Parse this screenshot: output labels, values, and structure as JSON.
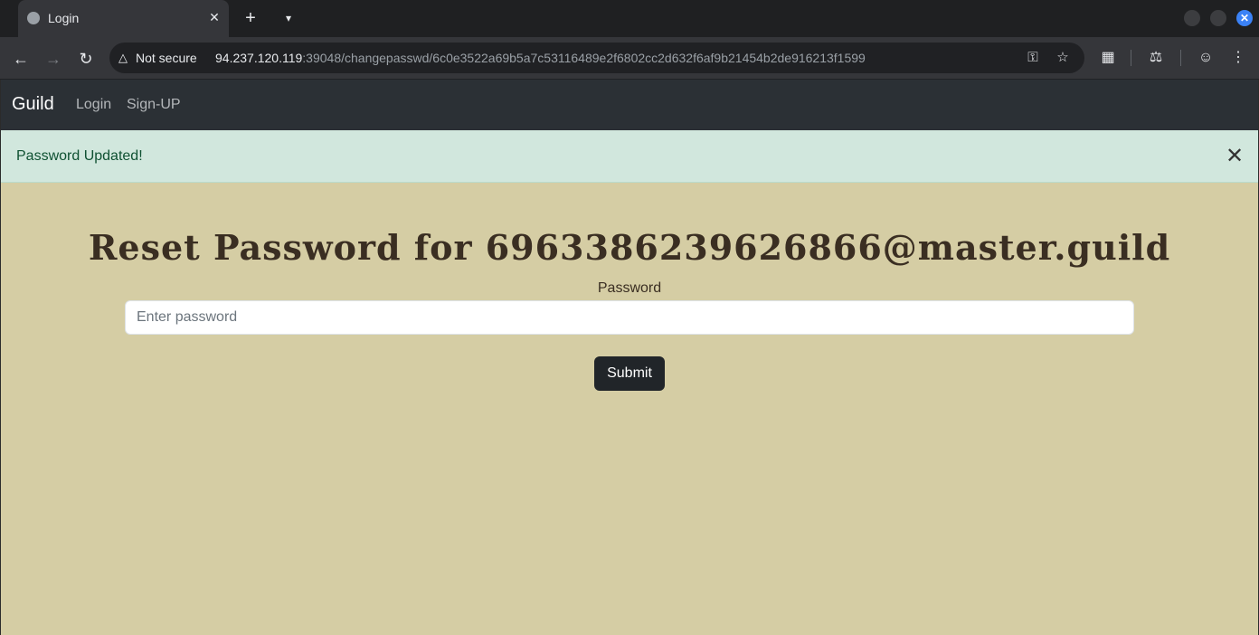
{
  "browser": {
    "tab_title": "Login",
    "tab_close": "✕",
    "new_tab": "+",
    "tab_menu": "⌄",
    "not_secure": "Not secure",
    "url_host": "94.237.120.119",
    "url_rest": ":39048/changepasswd/6c0e3522a69b5a7c53116489e2f6802cc2d632f6af9b21454b2de916213f1599",
    "icons": [
      "back-icon",
      "forward-icon",
      "reload-icon",
      "warning-icon",
      "key-icon",
      "star-icon",
      "extensions-icon",
      "labs-icon",
      "profile-icon",
      "menu-icon"
    ]
  },
  "navbar": {
    "brand": "Guild",
    "links": [
      "Login",
      "Sign-UP"
    ]
  },
  "alert": {
    "message": "Password Updated!",
    "close": "✕"
  },
  "form": {
    "heading": "Reset Password for 6963386239626866@master.guild",
    "password_label": "Password",
    "password_placeholder": "Enter password",
    "password_value": "",
    "submit_label": "Submit"
  },
  "colors": {
    "page_bg": "#d5cda4",
    "navbar_bg": "#2b3035",
    "alert_bg": "#d1e7dd",
    "alert_text": "#0f5132",
    "button_bg": "#212529"
  }
}
